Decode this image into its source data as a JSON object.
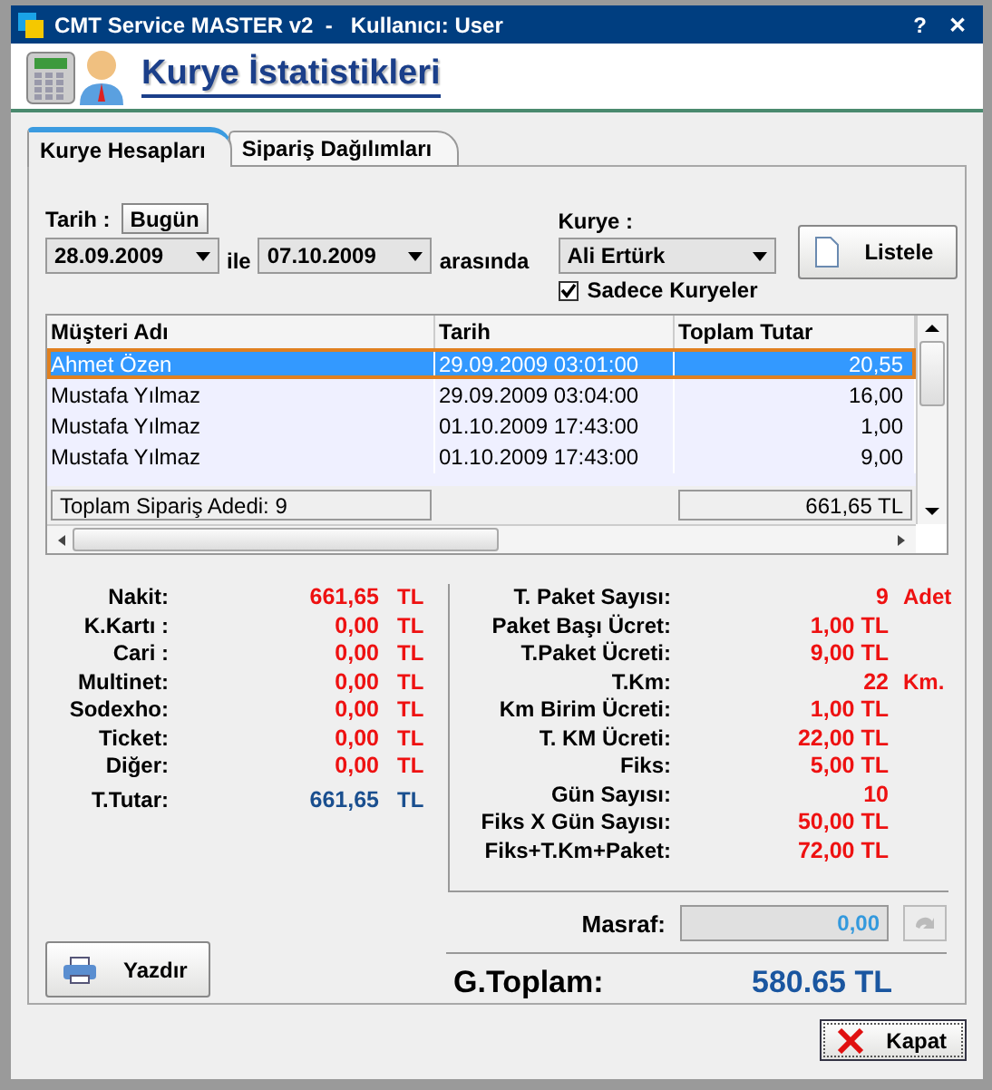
{
  "window": {
    "title": "CMT Service MASTER v2  -   Kullanıcı: User",
    "help": "?",
    "close": "✕"
  },
  "header": {
    "title": "Kurye İstatistikleri"
  },
  "tabs": [
    {
      "label": "Kurye Hesapları",
      "selected": true
    },
    {
      "label": "Sipariş Dağılımları",
      "selected": false
    }
  ],
  "filter": {
    "date_label": "Tarih :",
    "today_button": "Bugün",
    "start_date": "28.09.2009",
    "between": "ile",
    "end_date": "07.10.2009",
    "range_suffix": "arasında",
    "courier_label": "Kurye :",
    "courier": "Ali Ertürk",
    "only_couriers": {
      "label": "Sadece Kuryeler",
      "checked": true
    },
    "list_button": "Listele"
  },
  "table": {
    "columns": [
      "Müşteri Adı",
      "Tarih",
      "Toplam Tutar"
    ],
    "rows": [
      {
        "cells": [
          "Ahmet Özen",
          "29.09.2009 03:01:00",
          "20,55"
        ],
        "selected": true
      },
      {
        "cells": [
          "Mustafa Yılmaz",
          "29.09.2009 03:04:00",
          "16,00"
        ],
        "selected": false
      },
      {
        "cells": [
          "Mustafa Yılmaz",
          "01.10.2009 17:43:00",
          "1,00"
        ],
        "selected": false
      },
      {
        "cells": [
          "Mustafa Yılmaz",
          "01.10.2009 17:43:00",
          "9,00"
        ],
        "selected": false
      }
    ],
    "footer_count": "Toplam Sipariş Adedi: 9",
    "footer_total": "661,65 TL"
  },
  "payments": [
    {
      "label": "Nakit:",
      "value": "661,65",
      "unit": "TL",
      "kind": "amount"
    },
    {
      "label": "K.Kartı :",
      "value": "0,00",
      "unit": "TL",
      "kind": "amount"
    },
    {
      "label": "Cari :",
      "value": "0,00",
      "unit": "TL",
      "kind": "amount"
    },
    {
      "label": "Multinet:",
      "value": "0,00",
      "unit": "TL",
      "kind": "amount"
    },
    {
      "label": "Sodexho:",
      "value": "0,00",
      "unit": "TL",
      "kind": "amount"
    },
    {
      "label": "Ticket:",
      "value": "0,00",
      "unit": "TL",
      "kind": "amount"
    },
    {
      "label": "Diğer:",
      "value": "0,00",
      "unit": "TL",
      "kind": "amount"
    },
    {
      "label": "T.Tutar:",
      "value": "661,65",
      "unit": "TL",
      "kind": "total"
    }
  ],
  "courier_stats": [
    {
      "label": "T. Paket Sayısı:",
      "value": "9",
      "unit": "Adet"
    },
    {
      "label": "Paket Başı Ücret:",
      "value": "1,00 TL"
    },
    {
      "label": "T.Paket Ücreti:",
      "value": "9,00 TL"
    },
    {
      "label": "T.Km:",
      "value": "22",
      "unit": "Km."
    },
    {
      "label": "Km Birim Ücreti:",
      "value": "1,00 TL"
    },
    {
      "label": "T. KM Ücreti:",
      "value": "22,00 TL"
    },
    {
      "label": "Fiks:",
      "value": "5,00 TL"
    },
    {
      "label": "Gün Sayısı:",
      "value": "10"
    },
    {
      "label": "Fiks X Gün Sayısı:",
      "value": "50,00 TL"
    },
    {
      "label": "Fiks+T.Km+Paket:",
      "value": "72,00 TL"
    }
  ],
  "expense": {
    "label": "Masraf:",
    "value": "0,00"
  },
  "grand_total": {
    "label": "G.Toplam:",
    "value": "580.65 TL"
  },
  "print_button": "Yazdır",
  "close_button": "Kapat"
}
